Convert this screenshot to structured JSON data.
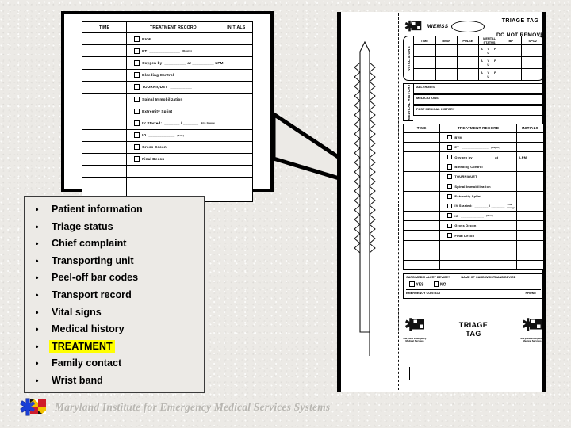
{
  "slide": {
    "background_color": "#eceae6",
    "highlight_color": "#ffff00"
  },
  "footer": {
    "organization": "Maryland Institute for Emergency Medical Services Systems",
    "logo_name": "miemss-star-of-life-logo"
  },
  "bullet_list": {
    "items": [
      {
        "label": "Patient information",
        "highlighted": false
      },
      {
        "label": "Triage status",
        "highlighted": false
      },
      {
        "label": "Chief complaint",
        "highlighted": false
      },
      {
        "label": "Transporting unit",
        "highlighted": false
      },
      {
        "label": "Peel-off bar codes",
        "highlighted": false
      },
      {
        "label": "Transport record",
        "highlighted": false
      },
      {
        "label": "Vital signs",
        "highlighted": false
      },
      {
        "label": "Medical history",
        "highlighted": false
      },
      {
        "label": "TREATMENT",
        "highlighted": true
      },
      {
        "label": "Family contact",
        "highlighted": false
      },
      {
        "label": "Wrist band",
        "highlighted": false
      }
    ],
    "bullet_glyph": "•"
  },
  "treatment_record": {
    "headers": {
      "time": "TIME",
      "record": "TREATMENT RECORD",
      "initials": "INITIALS"
    },
    "rows": [
      {
        "label": "BVM",
        "suffix": "",
        "note": ""
      },
      {
        "label": "ET",
        "suffix": "______________",
        "note": "(Depth)"
      },
      {
        "label": "Oxygen by",
        "suffix": "__________ at __________ LPM",
        "note": ""
      },
      {
        "label": "Bleeding Control",
        "suffix": "",
        "note": ""
      },
      {
        "label": "TOURNIQUET",
        "suffix": "__________",
        "note": ""
      },
      {
        "label": "Spinal Immobilization",
        "suffix": "",
        "note": ""
      },
      {
        "label": "Extremity Splint",
        "suffix": "",
        "note": ""
      },
      {
        "label": "IV Started:",
        "suffix": "_______ / _______",
        "note": "Site        Gauge"
      },
      {
        "label": "IO",
        "suffix": "____________",
        "note": "(Site)"
      },
      {
        "label": "Gross Decon",
        "suffix": "",
        "note": ""
      },
      {
        "label": "Final Decon",
        "suffix": "",
        "note": ""
      }
    ],
    "blank_rows": 3
  },
  "triage_tag": {
    "brand": "MIEMSS",
    "title_line1": "TRIAGE TAG",
    "title_line2": "DO NOT REMOVE",
    "vital_signs": {
      "section_label": "VITAL SIGNS",
      "columns": [
        "TIME",
        "RESP",
        "PULSE",
        "MENTAL STATUS",
        "BP",
        "SPO2"
      ],
      "mental_status_scale": "A V P U",
      "row_count": 3
    },
    "medical_history": {
      "section_label": "MEDICAL HISTORY",
      "fields": [
        "ALLERGIES",
        "MEDICATIONS",
        "PAST MEDICAL HISTORY"
      ]
    },
    "alert_device": {
      "question": "CARD/MEDIC ALERT DEVICE?",
      "name_field": "NAME OF CARD/WRISTBAND/DEVICE",
      "option_yes": "YES",
      "option_no": "NO",
      "contact_label": "EMERGENCY CONTACT",
      "phone_label": "PHONE"
    },
    "bottom": {
      "title_line1": "TRIAGE",
      "title_line2": "TAG",
      "logo_caption_line1": "Maryland Emergency",
      "logo_caption_line2": "Medical Services"
    },
    "wristband_name": "perforated-wristband-strip"
  }
}
